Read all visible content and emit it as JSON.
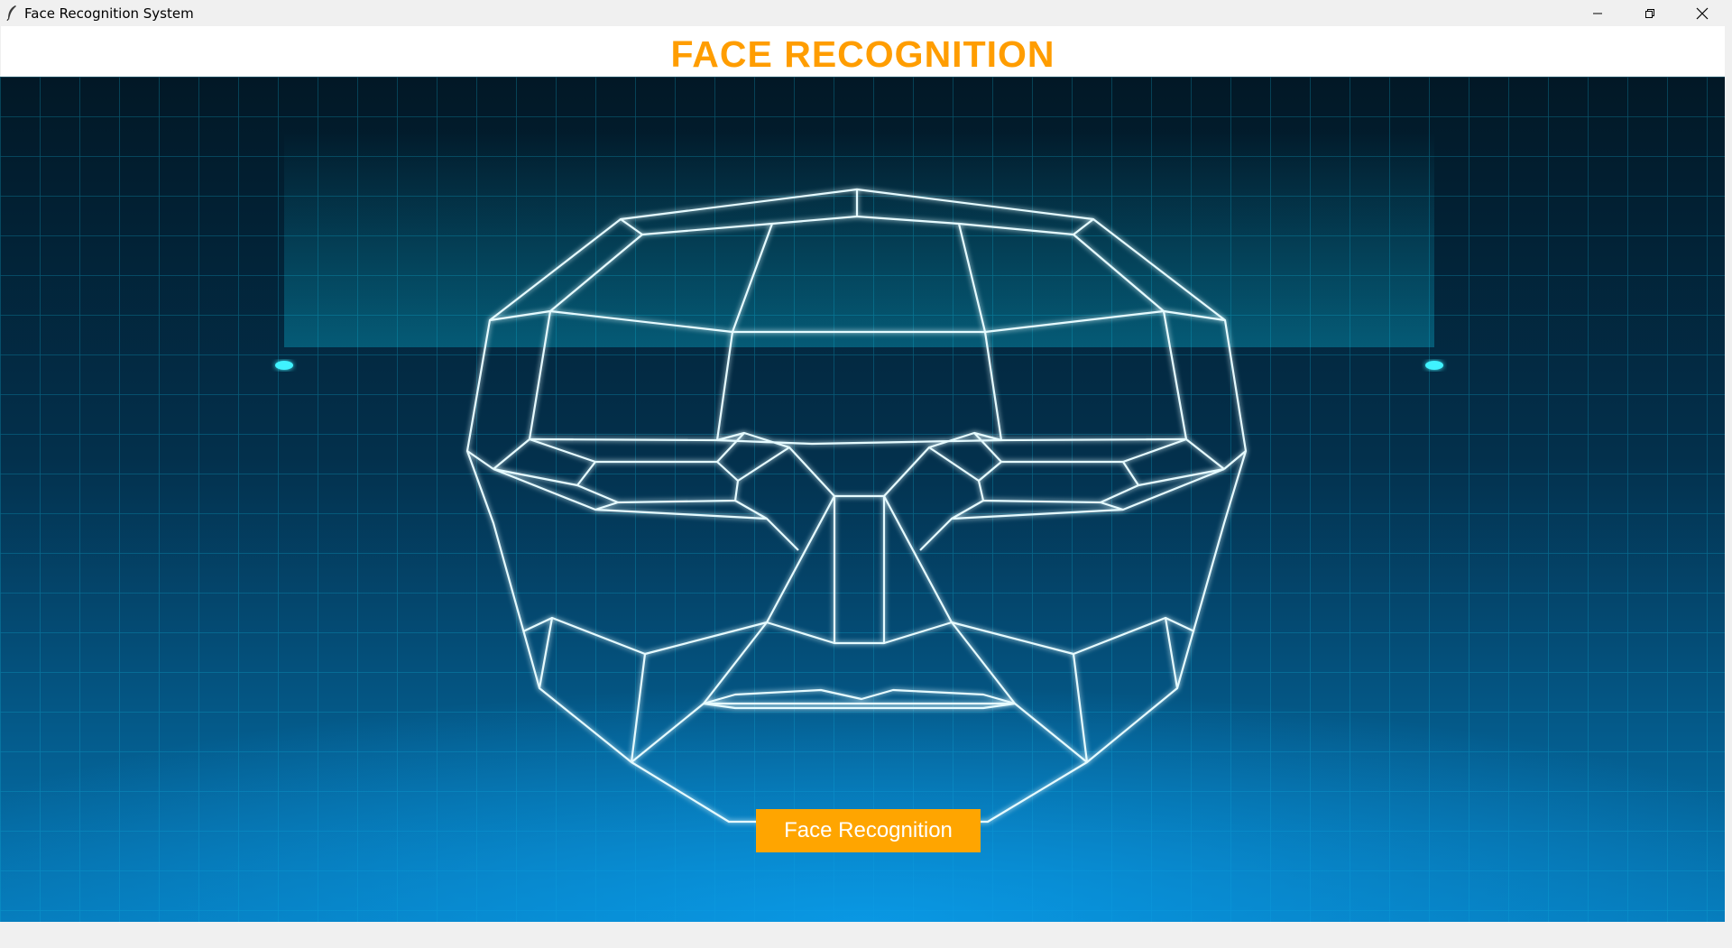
{
  "window": {
    "title": "Face Recognition System",
    "icons": {
      "app": "feather-icon",
      "minimize": "minimize-icon",
      "maximize": "restore-icon",
      "close": "close-icon"
    }
  },
  "header": {
    "title": "FACE RECOGNITION",
    "title_color": "#ff9d00"
  },
  "main": {
    "background_image": "face-wireframe-scan-graphic",
    "action_button_label": "Face Recognition",
    "action_button_color": "#ffa500"
  }
}
